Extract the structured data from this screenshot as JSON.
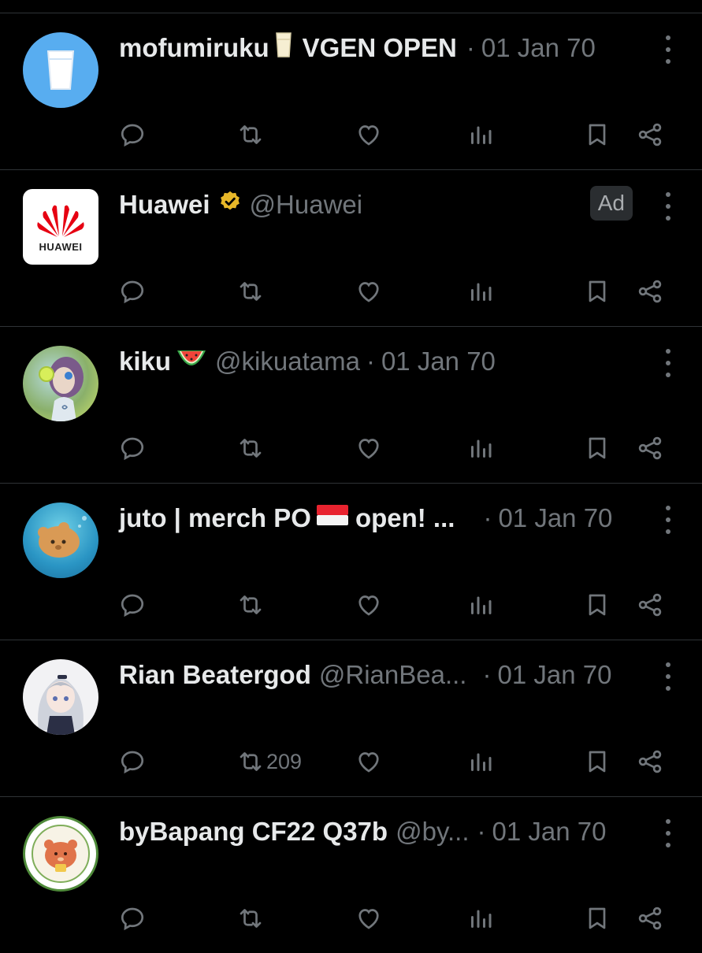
{
  "colors": {
    "background": "#000000",
    "text": "#e7e9ea",
    "muted": "#71767b",
    "divider": "#2f3336",
    "verified_gold": "#e8b829"
  },
  "tweets": [
    {
      "name": "mofumiruku",
      "emoji": "milk-glass",
      "name_suffix": "VGEN OPEN",
      "handle": "",
      "separator": "·",
      "time": "01 Jan 70",
      "avatar": "milk-glass-avatar",
      "retweet_count": ""
    },
    {
      "name": "Huawei",
      "verified": true,
      "handle": "@Huawei",
      "ad_label": "Ad",
      "avatar": "huawei-logo",
      "logo_text": "HUAWEI",
      "retweet_count": ""
    },
    {
      "name": "kiku",
      "emoji": "watermelon",
      "handle": "@kikuatama",
      "separator": "·",
      "time": "01 Jan 70",
      "avatar": "anime-character-avatar",
      "retweet_count": ""
    },
    {
      "name": "juto | merch PO",
      "emoji": "indonesia-flag",
      "name_suffix": "open! ...",
      "handle": "",
      "separator": "·",
      "time": "01 Jan 70",
      "avatar": "bear-underwater-avatar",
      "retweet_count": ""
    },
    {
      "name": "Rian Beatergod",
      "handle": "@RianBea...",
      "separator": "·",
      "time": "01 Jan 70",
      "avatar": "anime-girl-avatar",
      "retweet_count": "209"
    },
    {
      "name": "byBapang CF22 Q37b",
      "handle": "@by...",
      "separator": "·",
      "time": "01 Jan 70",
      "avatar": "bear-mascot-avatar",
      "retweet_count": ""
    }
  ]
}
